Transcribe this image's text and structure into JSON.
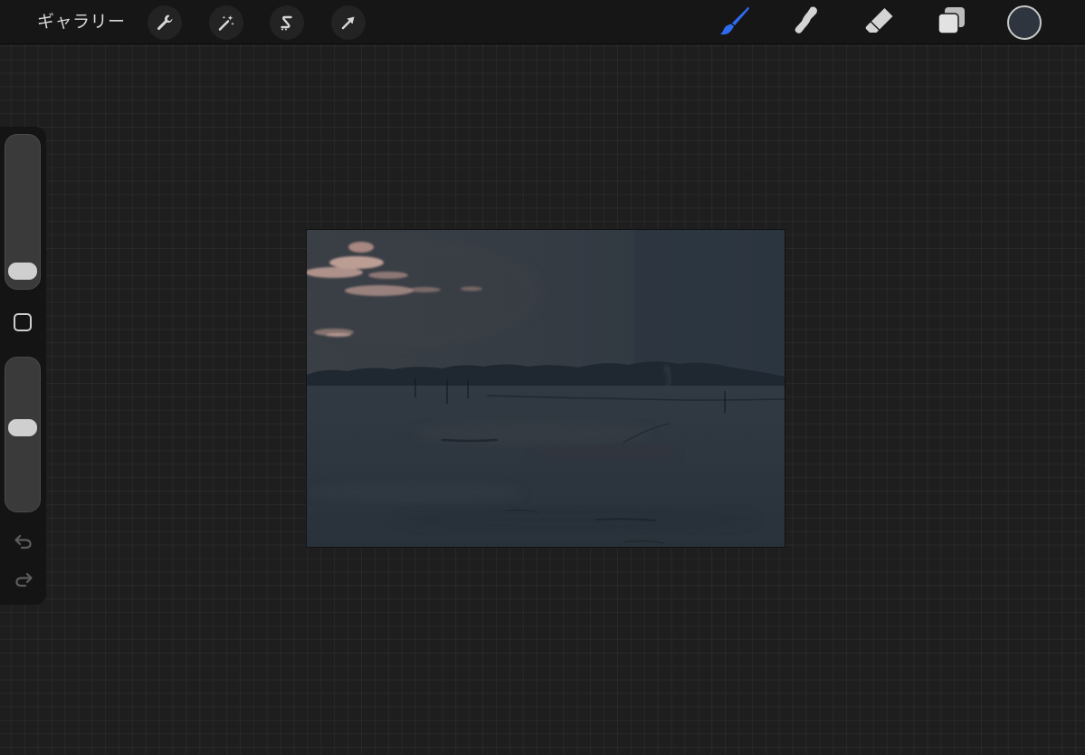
{
  "toolbar": {
    "gallery_label": "ギャラリー",
    "left_tools": [
      {
        "name": "actions",
        "icon": "wrench-icon"
      },
      {
        "name": "adjustments",
        "icon": "magic-wand-icon"
      },
      {
        "name": "selection",
        "icon": "selection-s-icon"
      },
      {
        "name": "transform",
        "icon": "arrow-cursor-icon"
      }
    ],
    "right_tools": [
      {
        "name": "brush",
        "icon": "paintbrush-icon",
        "active": true
      },
      {
        "name": "smudge",
        "icon": "smudge-finger-icon",
        "active": false
      },
      {
        "name": "eraser",
        "icon": "eraser-icon",
        "active": false
      },
      {
        "name": "layers",
        "icon": "layers-icon",
        "active": false
      }
    ],
    "current_color": "#2e353e",
    "active_tool_color": "#2f6bf0"
  },
  "sidebar": {
    "brush_size_level": 0.05,
    "opacity_level": 0.55,
    "modify_button_icon": "square-icon",
    "undo_icon": "undo-arrow-icon",
    "redo_icon": "redo-arrow-icon"
  },
  "canvas": {
    "artwork": "landscape-painting",
    "palette": {
      "sky": "#353c44",
      "sky_right": "#2d3640",
      "clouds": "#c9a79c",
      "treeline": "#1f2730",
      "ground": "#2c343d"
    }
  }
}
